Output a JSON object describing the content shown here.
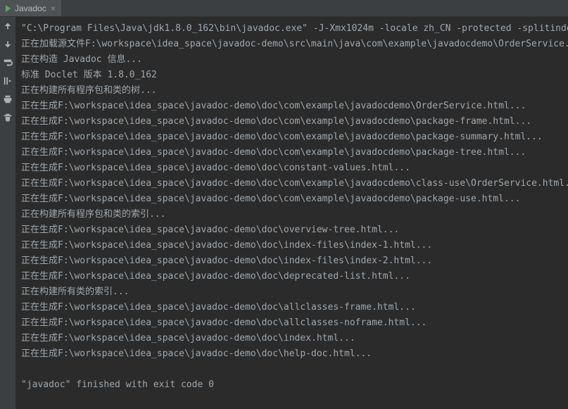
{
  "tab": {
    "label": "Javadoc"
  },
  "console": {
    "lines": [
      "\"C:\\Program Files\\Java\\jdk1.8.0_162\\bin\\javadoc.exe\" -J-Xmx1024m -locale zh_CN -protected -splitindex -use -au",
      "正在加载源文件F:\\workspace\\idea_space\\javadoc-demo\\src\\main\\java\\com\\example\\javadocdemo\\OrderService.java...",
      "正在构造 Javadoc 信息...",
      "标准 Doclet 版本 1.8.0_162",
      "正在构建所有程序包和类的树...",
      "正在生成F:\\workspace\\idea_space\\javadoc-demo\\doc\\com\\example\\javadocdemo\\OrderService.html...",
      "正在生成F:\\workspace\\idea_space\\javadoc-demo\\doc\\com\\example\\javadocdemo\\package-frame.html...",
      "正在生成F:\\workspace\\idea_space\\javadoc-demo\\doc\\com\\example\\javadocdemo\\package-summary.html...",
      "正在生成F:\\workspace\\idea_space\\javadoc-demo\\doc\\com\\example\\javadocdemo\\package-tree.html...",
      "正在生成F:\\workspace\\idea_space\\javadoc-demo\\doc\\constant-values.html...",
      "正在生成F:\\workspace\\idea_space\\javadoc-demo\\doc\\com\\example\\javadocdemo\\class-use\\OrderService.html...",
      "正在生成F:\\workspace\\idea_space\\javadoc-demo\\doc\\com\\example\\javadocdemo\\package-use.html...",
      "正在构建所有程序包和类的索引...",
      "正在生成F:\\workspace\\idea_space\\javadoc-demo\\doc\\overview-tree.html...",
      "正在生成F:\\workspace\\idea_space\\javadoc-demo\\doc\\index-files\\index-1.html...",
      "正在生成F:\\workspace\\idea_space\\javadoc-demo\\doc\\index-files\\index-2.html...",
      "正在生成F:\\workspace\\idea_space\\javadoc-demo\\doc\\deprecated-list.html...",
      "正在构建所有类的索引...",
      "正在生成F:\\workspace\\idea_space\\javadoc-demo\\doc\\allclasses-frame.html...",
      "正在生成F:\\workspace\\idea_space\\javadoc-demo\\doc\\allclasses-noframe.html...",
      "正在生成F:\\workspace\\idea_space\\javadoc-demo\\doc\\index.html...",
      "正在生成F:\\workspace\\idea_space\\javadoc-demo\\doc\\help-doc.html...",
      "",
      "\"javadoc\" finished with exit code 0"
    ]
  }
}
